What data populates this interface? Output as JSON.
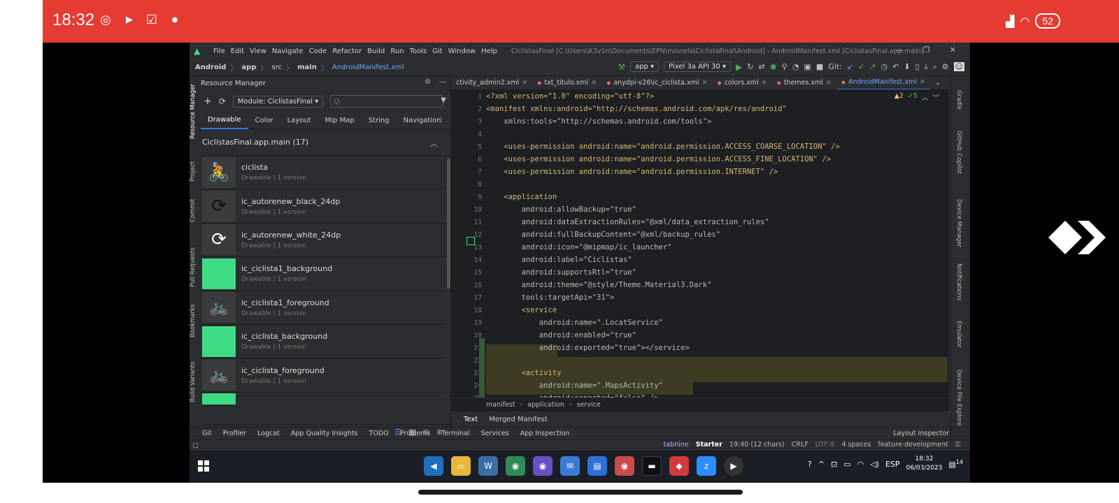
{
  "phone_status": {
    "time": "18:32",
    "battery": "52",
    "icons": [
      "whatsapp-icon",
      "play-icon",
      "check-icon",
      "dot-icon",
      "signal-icon",
      "wifi-icon"
    ]
  },
  "menu": {
    "items": [
      "File",
      "Edit",
      "View",
      "Navigate",
      "Code",
      "Refactor",
      "Build",
      "Run",
      "Tools",
      "Git",
      "Window",
      "Help"
    ],
    "title": "CiclistasFinal [C:\\Users\\K3v1n\\Documents\\EPN\\moviels\\CiclistaFinal\\Android] - AndroidManifest.xml [CiclistasFinal.app.main]"
  },
  "navbar": {
    "crumbs": [
      "Android",
      "app",
      "src",
      "main"
    ],
    "file": "AndroidManifest.xml",
    "run_config": "app",
    "device": "Pixel 3a API 30",
    "git_label": "Git:"
  },
  "left_strip": [
    "Resource Manager",
    "Project",
    "Commit",
    "Pull Requests",
    "Bookmarks",
    "Build Variants"
  ],
  "resource_manager": {
    "title": "Resource Manager",
    "module": "Module: CiclistasFinal",
    "search_placeholder": "Q-",
    "tabs": [
      "Drawable",
      "Color",
      "Layout",
      "Mip Map",
      "String",
      "Navigation"
    ],
    "group": "CiclistasFinal.app.main (17)",
    "items": [
      {
        "name": "ciclista",
        "meta": "Drawable  |  1 version",
        "thumb": "🚴"
      },
      {
        "name": "ic_autorenew_black_24dp",
        "meta": "Drawable  |  1 version",
        "thumb": "⟳"
      },
      {
        "name": "ic_autorenew_white_24dp",
        "meta": "Drawable  |  1 version",
        "thumb": "⟳"
      },
      {
        "name": "ic_ciclista1_background",
        "meta": "Drawable  |  1 version",
        "thumb": ""
      },
      {
        "name": "ic_ciclista1_foreground",
        "meta": "Drawable  |  1 version",
        "thumb": "🚲"
      },
      {
        "name": "ic_ciclista_background",
        "meta": "Drawable  |  1 version",
        "thumb": ""
      },
      {
        "name": "ic_ciclista_foreground",
        "meta": "Drawable  |  1 version",
        "thumb": "🚲"
      }
    ]
  },
  "editor_tabs": [
    "ctivity_admin2.xml",
    "txt_titulo.xml",
    "anydpi-v26\\ic_ciclista.xml",
    "colors.xml",
    "themes.xml",
    "AndroidManifest.xml"
  ],
  "editor_status": {
    "warnings": "▲2",
    "ok": "✓5"
  },
  "code_lines": [
    {
      "n": "1",
      "text": "<?xml version=\"1.0\" encoding=\"utf-8\"?>"
    },
    {
      "n": "2",
      "text": "<manifest xmlns:android=\"http://schemas.android.com/apk/res/android\""
    },
    {
      "n": "3",
      "text": "    xmlns:tools=\"http://schemas.android.com/tools\">"
    },
    {
      "n": "4",
      "text": ""
    },
    {
      "n": "5",
      "text": "    <uses-permission android:name=\"android.permission.ACCESS_COARSE_LOCATION\" />"
    },
    {
      "n": "6",
      "text": "    <uses-permission android:name=\"android.permission.ACCESS_FINE_LOCATION\" />"
    },
    {
      "n": "7",
      "text": "    <uses-permission android:name=\"android.permission.INTERNET\" />"
    },
    {
      "n": "8",
      "text": ""
    },
    {
      "n": "9",
      "text": "    <application"
    },
    {
      "n": "10",
      "text": "        android:allowBackup=\"true\""
    },
    {
      "n": "11",
      "text": "        android:dataExtractionRules=\"@xml/data_extraction_rules\""
    },
    {
      "n": "12",
      "text": "        android:fullBackupContent=\"@xml/backup_rules\""
    },
    {
      "n": "13",
      "text": "        android:icon=\"@mipmap/ic_launcher\""
    },
    {
      "n": "14",
      "text": "        android:label=\"Ciclistas\""
    },
    {
      "n": "15",
      "text": "        android:supportsRtl=\"true\""
    },
    {
      "n": "16",
      "text": "        android:theme=\"@style/Theme.Material3.Dark\""
    },
    {
      "n": "17",
      "text": "        tools:targetApi=\"31\">"
    },
    {
      "n": "18",
      "text": "        <service"
    },
    {
      "n": "19",
      "text": "            android:name=\".LocatService\""
    },
    {
      "n": "20",
      "text": "            android:enabled=\"true\""
    },
    {
      "n": "21",
      "text": "            android:exported=\"true\"></service>"
    },
    {
      "n": "22",
      "text": ""
    },
    {
      "n": "23",
      "text": "        <activity"
    },
    {
      "n": "24",
      "text": "            android:name=\".MapsActivity\""
    },
    {
      "n": "25",
      "text": "            android:exported=\"false\" />"
    }
  ],
  "xml_crumbs": [
    "manifest",
    "application",
    "service"
  ],
  "bottom_tabs": [
    "Text",
    "Merged Manifest"
  ],
  "right_strip": [
    "Gradle",
    "GitHub Copilot",
    "Device Manager",
    "Notifications",
    "Emulator",
    "Device File Explore"
  ],
  "toolwindows": [
    "Git",
    "Profiler",
    "Logcat",
    "App Quality Insights",
    "TODO",
    "Problems",
    "Terminal",
    "Services",
    "App Inspection"
  ],
  "layout_inspector": "Layout Inspector",
  "ide_status": {
    "tabnine": "tabnine",
    "starter": "Starter",
    "position": "19:40 (12 chars)",
    "line_sep": "CRLF",
    "encoding": "UTF-8",
    "indent": "4 spaces",
    "branch": "feature-development"
  },
  "taskbar": {
    "time": "18:32",
    "date": "06/03/2023",
    "lang": "ESP",
    "notifications": "14"
  }
}
